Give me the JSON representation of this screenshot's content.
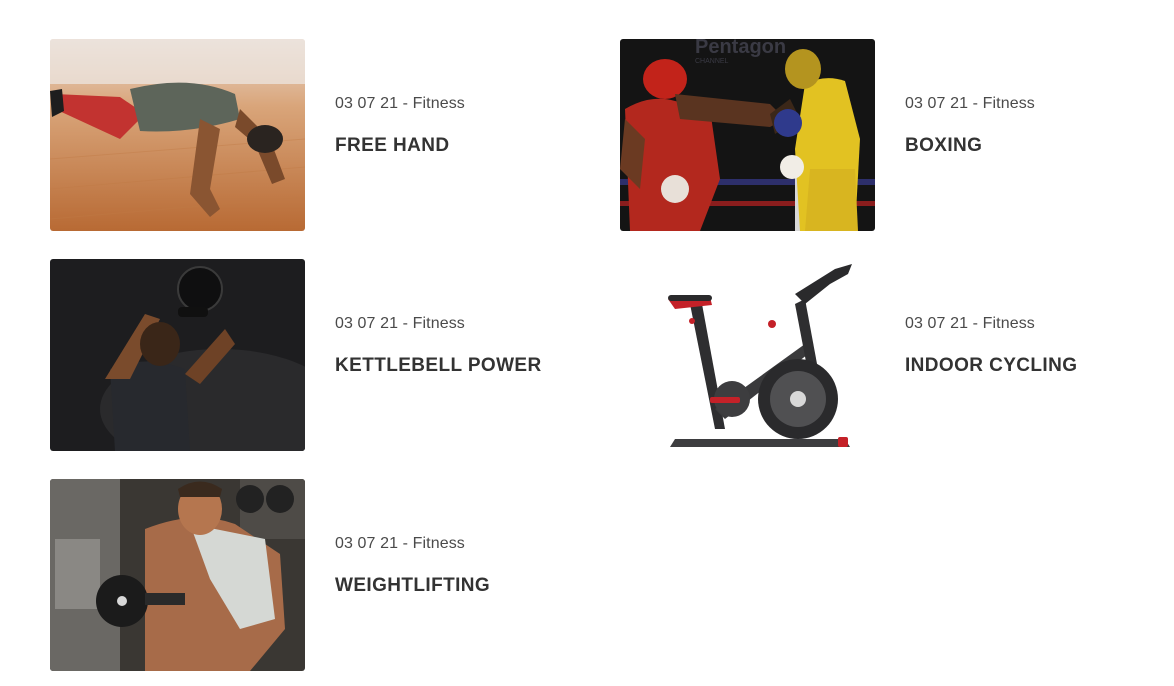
{
  "posts": [
    {
      "date": "03 07 21",
      "category": "Fitness",
      "title": "FREE HAND",
      "image": "push-up-photo"
    },
    {
      "date": "03 07 21",
      "category": "Fitness",
      "title": "BOXING",
      "image": "boxing-photo",
      "image_watermark": "Pentagon",
      "image_watermark_sub": "CHANNEL"
    },
    {
      "date": "03 07 21",
      "category": "Fitness",
      "title": "KETTLEBELL POWER",
      "image": "kettlebell-photo"
    },
    {
      "date": "03 07 21",
      "category": "Fitness",
      "title": "INDOOR CYCLING",
      "image": "exercise-bike-photo"
    },
    {
      "date": "03 07 21",
      "category": "Fitness",
      "title": "WEIGHTLIFTING",
      "image": "weightlifting-photo"
    }
  ],
  "meta_separator": " - ",
  "colors": {
    "title": "#333333",
    "meta": "#4a4a4a",
    "background": "#ffffff"
  }
}
